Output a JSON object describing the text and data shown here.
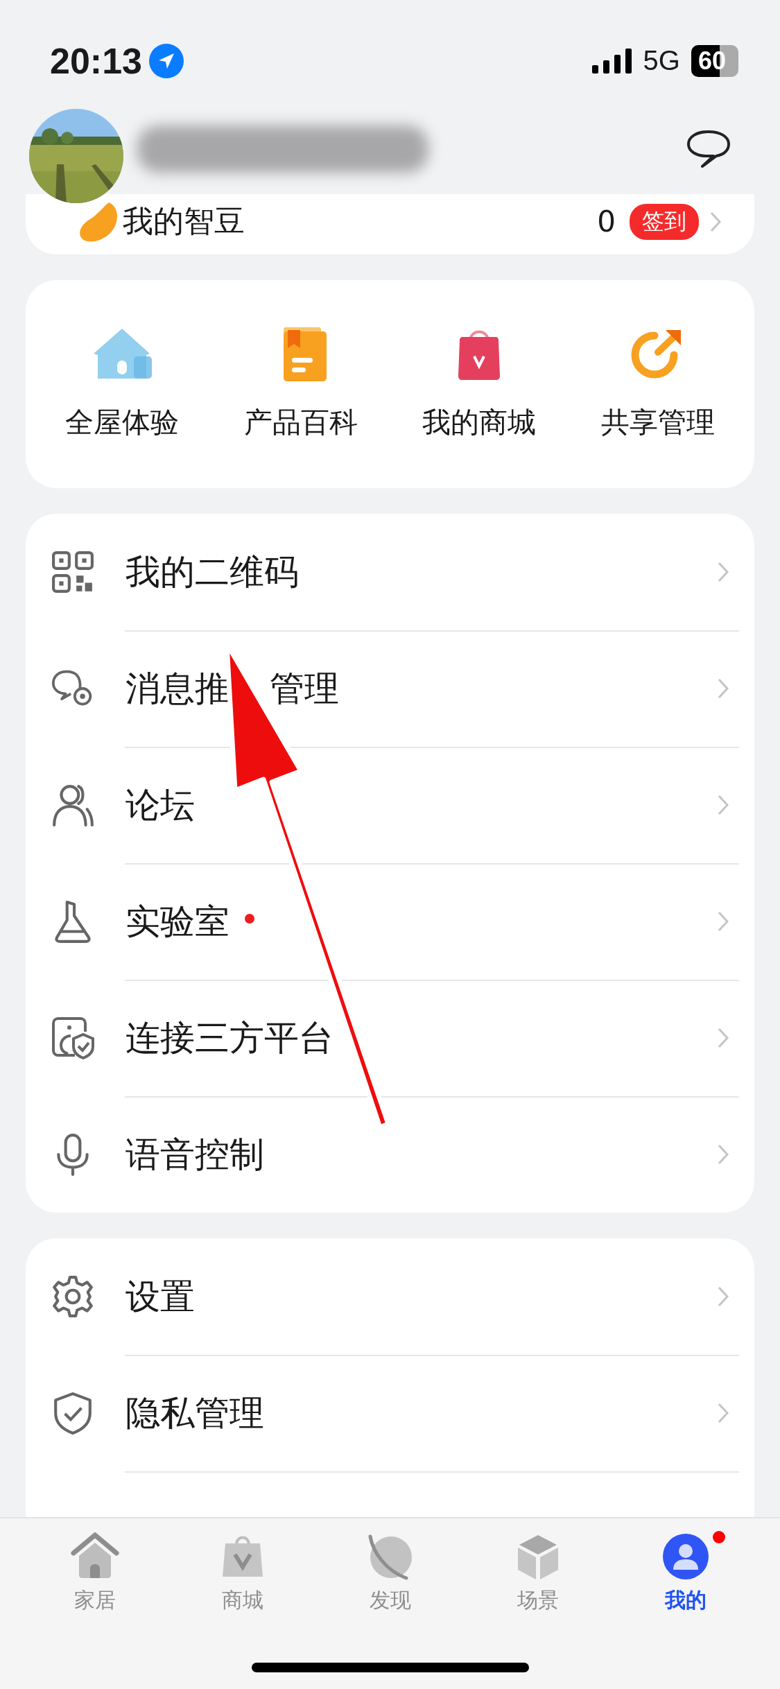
{
  "status_bar": {
    "time": "20:13",
    "network": "5G",
    "battery": "60"
  },
  "beans": {
    "label": "我的智豆",
    "value": "0",
    "action": "签到"
  },
  "shortcuts": [
    {
      "label": "全屋体验"
    },
    {
      "label": "产品百科"
    },
    {
      "label": "我的商城"
    },
    {
      "label": "共享管理"
    }
  ],
  "menu": [
    {
      "label": "我的二维码",
      "dot": false
    },
    {
      "label": "消息推",
      "label_rest": "管理",
      "dot": false
    },
    {
      "label": "论坛",
      "dot": false
    },
    {
      "label": "实验室",
      "dot": true
    },
    {
      "label": "连接三方平台",
      "dot": false
    },
    {
      "label": "语音控制",
      "dot": false
    }
  ],
  "settings": [
    {
      "label": "设置"
    },
    {
      "label": "隐私管理"
    }
  ],
  "tabs": [
    {
      "label": "家居",
      "selected": false,
      "dot": false
    },
    {
      "label": "商城",
      "selected": false,
      "dot": false
    },
    {
      "label": "发现",
      "selected": false,
      "dot": false
    },
    {
      "label": "场景",
      "selected": false,
      "dot": false
    },
    {
      "label": "我的",
      "selected": true,
      "dot": true
    }
  ]
}
